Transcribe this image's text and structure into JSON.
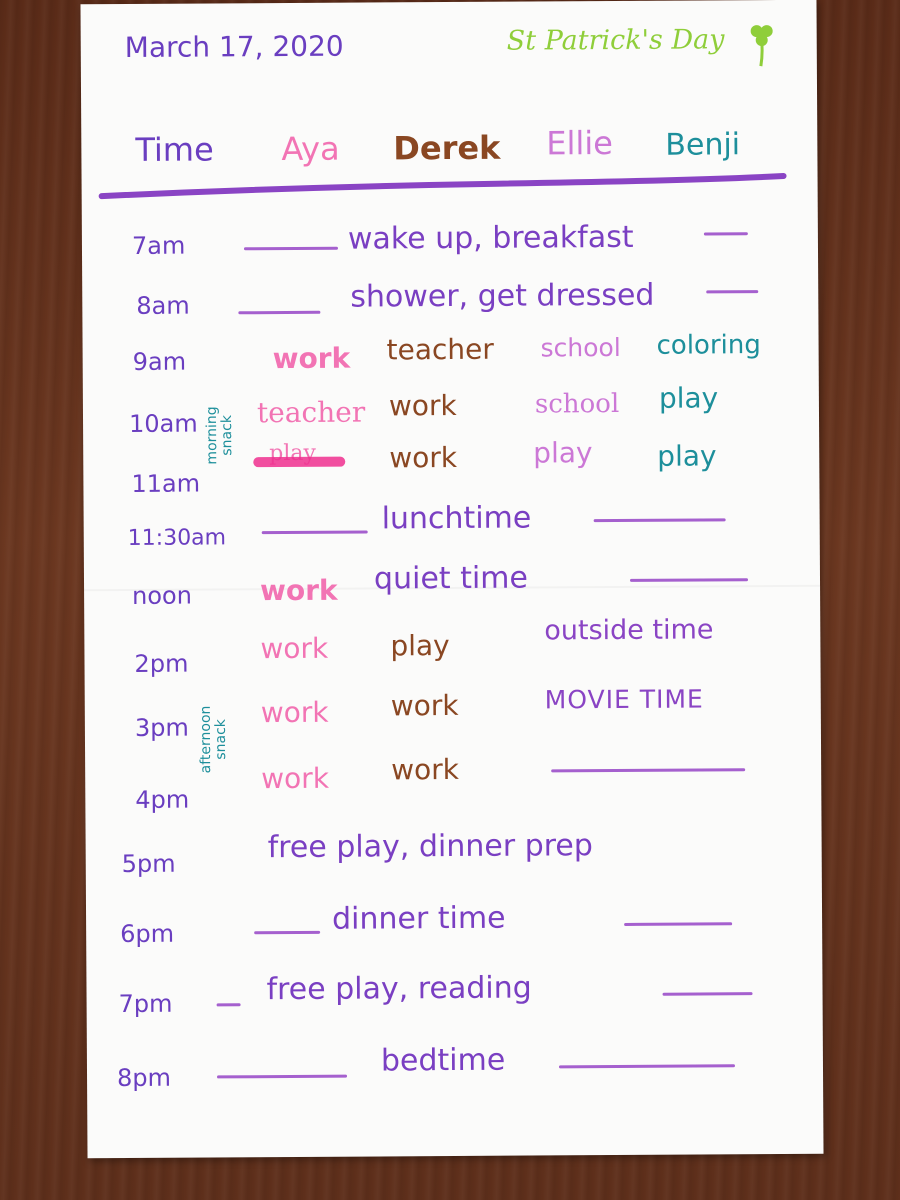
{
  "header": {
    "date": "March 17, 2020",
    "occasion": "St Patrick's Day"
  },
  "columns": {
    "time": "Time",
    "aya": "Aya",
    "derek": "Derek",
    "ellie": "Ellie",
    "benji": "Benji"
  },
  "notes": {
    "morning_snack": [
      "morning",
      "snack"
    ],
    "afternoon_snack": [
      "afternoon",
      "snack"
    ]
  },
  "rows": [
    {
      "time": "7am",
      "activity": "wake up, breakfast"
    },
    {
      "time": "8am",
      "activity": "shower, get dressed"
    },
    {
      "time": "9am",
      "aya": "work",
      "derek": "teacher",
      "ellie": "school",
      "benji": "coloring"
    },
    {
      "time": "10am",
      "aya": "teacher",
      "derek": "work",
      "ellie": "school",
      "benji": "play"
    },
    {
      "time": "11am",
      "aya": "play",
      "derek": "work",
      "ellie": "play",
      "benji": "play"
    },
    {
      "time": "11:30am",
      "activity": "lunchtime"
    },
    {
      "time": "noon",
      "aya": "work",
      "shared": "quiet time"
    },
    {
      "time": "2pm",
      "aya": "work",
      "derek": "play",
      "shared": "outside time"
    },
    {
      "time": "3pm",
      "aya": "work",
      "derek": "work",
      "shared": "MOVIE TIME"
    },
    {
      "time": "4pm",
      "aya": "work",
      "derek": "work"
    },
    {
      "time": "5pm",
      "activity": "free play, dinner prep"
    },
    {
      "time": "6pm",
      "activity": "dinner time"
    },
    {
      "time": "7pm",
      "activity": "free play, reading"
    },
    {
      "time": "8pm",
      "activity": "bedtime"
    }
  ],
  "colors": {
    "time_ink": "#6a3ec0",
    "aya_ink": "#f274b4",
    "derek_ink": "#8a4722",
    "ellie_ink": "#cc78d6",
    "benji_ink": "#1d8f9b",
    "title_ink": "#8fce3a",
    "divider_ink": "#8a44c4",
    "table_bg": "#5e2f1b",
    "paper": "#fbfbfa"
  },
  "icons": {
    "shamrock": "shamrock-icon"
  }
}
